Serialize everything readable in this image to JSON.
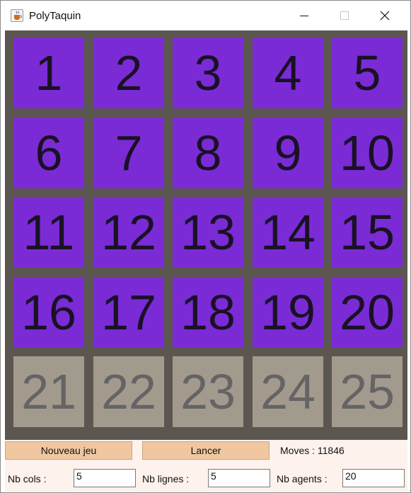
{
  "window": {
    "title": "PolyTaquin",
    "icon": "java-cup-icon",
    "controls": [
      "minimize-icon",
      "maximize-icon",
      "close-icon"
    ]
  },
  "board": {
    "rows": 5,
    "cols": 5,
    "tiles": [
      "1",
      "2",
      "3",
      "4",
      "5",
      "6",
      "7",
      "8",
      "9",
      "10",
      "11",
      "12",
      "13",
      "14",
      "15",
      "16",
      "17",
      "18",
      "19",
      "20",
      "21",
      "22",
      "23",
      "24",
      "25"
    ],
    "placed_color": "#7a2bd6",
    "unplaced_color": "#a39a8e",
    "background_color": "#5c5650"
  },
  "controls": {
    "new_game_label": "Nouveau jeu",
    "launch_label": "Lancer",
    "moves_text": "Moves : 11846",
    "cols_label": "Nb cols :",
    "cols_value": "5",
    "rows_label": "Nb lignes :",
    "rows_value": "5",
    "agents_label": "Nb agents :",
    "agents_value": "20"
  }
}
